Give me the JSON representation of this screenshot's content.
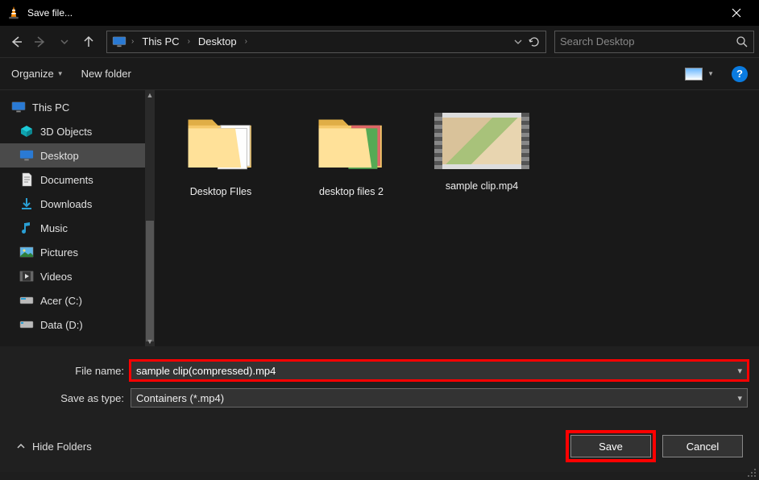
{
  "title": "Save file...",
  "breadcrumbs": [
    "This PC",
    "Desktop"
  ],
  "search_placeholder": "Search Desktop",
  "toolbar": {
    "organize": "Organize",
    "newfolder": "New folder"
  },
  "sidebar": {
    "root": "This PC",
    "items": [
      {
        "label": "3D Objects",
        "icon": "3d"
      },
      {
        "label": "Desktop",
        "icon": "desktop",
        "selected": true
      },
      {
        "label": "Documents",
        "icon": "documents"
      },
      {
        "label": "Downloads",
        "icon": "downloads"
      },
      {
        "label": "Music",
        "icon": "music"
      },
      {
        "label": "Pictures",
        "icon": "pictures"
      },
      {
        "label": "Videos",
        "icon": "videos"
      },
      {
        "label": "Acer (C:)",
        "icon": "drive"
      },
      {
        "label": "Data (D:)",
        "icon": "drive"
      }
    ]
  },
  "files": [
    {
      "label": "Desktop FIles",
      "type": "folder"
    },
    {
      "label": "desktop files 2",
      "type": "folder"
    },
    {
      "label": "sample clip.mp4",
      "type": "video"
    }
  ],
  "form": {
    "filename_label": "File name:",
    "filename_value": "sample clip(compressed).mp4",
    "savetype_label": "Save as type:",
    "savetype_value": "Containers (*.mp4)"
  },
  "footer": {
    "hide_folders": "Hide Folders",
    "save": "Save",
    "cancel": "Cancel"
  }
}
